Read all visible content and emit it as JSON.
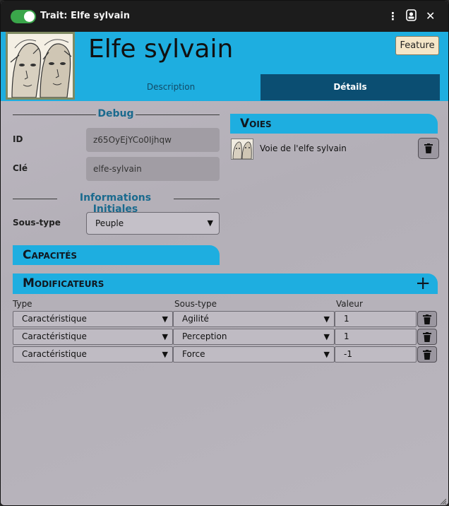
{
  "window": {
    "title": "Trait: Elfe sylvain",
    "menu_icon": "vertical-ellipsis-icon",
    "token_icon": "token-icon",
    "close_icon": "close-icon",
    "close_glyph": "✕",
    "menu_glyph": "⋮",
    "toggle_on": true
  },
  "header": {
    "name": "Elfe sylvain",
    "badge": "Feature",
    "tabs": [
      {
        "label": "Description",
        "active": false
      },
      {
        "label": "Détails",
        "active": true
      }
    ]
  },
  "debug": {
    "title": "Debug",
    "id_label": "ID",
    "id_value": "z65OyEjYCo0Ijhqw",
    "key_label": "Clé",
    "key_value": "elfe-sylvain"
  },
  "initial": {
    "title": "Informations Initiales",
    "subtype_label": "Sous-type",
    "subtype_value": "Peuple"
  },
  "voies": {
    "title": "Voies",
    "items": [
      {
        "label": "Voie de l'elfe sylvain"
      }
    ]
  },
  "capacites": {
    "title": "Capacités"
  },
  "modificateurs": {
    "title": "Modificateurs",
    "add_glyph": "+",
    "columns": [
      "Type",
      "Sous-type",
      "Valeur"
    ],
    "rows": [
      {
        "type": "Caractéristique",
        "subtype": "Agilité",
        "value": "1"
      },
      {
        "type": "Caractéristique",
        "subtype": "Perception",
        "value": "1"
      },
      {
        "type": "Caractéristique",
        "subtype": "Force",
        "value": "-1"
      }
    ]
  },
  "colors": {
    "accent": "#1eaee0",
    "tab_active": "#0b4e72",
    "titlebar": "#1c1c1c",
    "toggle": "#3aa64a",
    "section_title": "#1a6a8e"
  }
}
